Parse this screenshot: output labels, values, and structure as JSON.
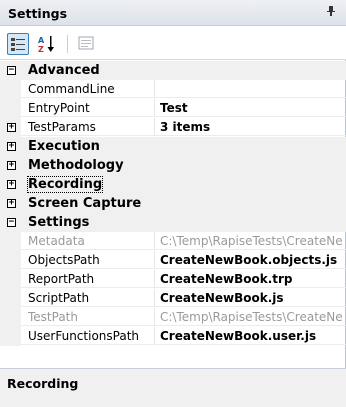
{
  "panel": {
    "title": "Settings",
    "pin_glyph": "p"
  },
  "toolbar": {
    "categorized_icon": "categorized-icon",
    "alphabetical_icon": "sort-az-icon",
    "property_pages_icon": "property-pages-icon"
  },
  "grid": {
    "categories": [
      {
        "label": "Advanced",
        "expanded": true,
        "props": [
          {
            "name": "CommandLine",
            "value": ""
          },
          {
            "name": "EntryPoint",
            "value": "Test"
          },
          {
            "name": "TestParams",
            "value": "3 items",
            "expandable": true
          }
        ]
      },
      {
        "label": "Execution",
        "expanded": false
      },
      {
        "label": "Methodology",
        "expanded": false
      },
      {
        "label": "Recording",
        "expanded": false,
        "focused": true
      },
      {
        "label": "Screen Capture",
        "expanded": false
      },
      {
        "label": "Settings",
        "expanded": true,
        "props": [
          {
            "name": "Metadata",
            "value": "C:\\Temp\\RapiseTests\\CreateNe",
            "readonly": true
          },
          {
            "name": "ObjectsPath",
            "value": "CreateNewBook.objects.js"
          },
          {
            "name": "ReportPath",
            "value": "CreateNewBook.trp"
          },
          {
            "name": "ScriptPath",
            "value": "CreateNewBook.js"
          },
          {
            "name": "TestPath",
            "value": "C:\\Temp\\RapiseTests\\CreateNe",
            "readonly": true
          },
          {
            "name": "UserFunctionsPath",
            "value": "CreateNewBook.user.js"
          }
        ]
      }
    ]
  },
  "description": {
    "title": "Recording"
  }
}
